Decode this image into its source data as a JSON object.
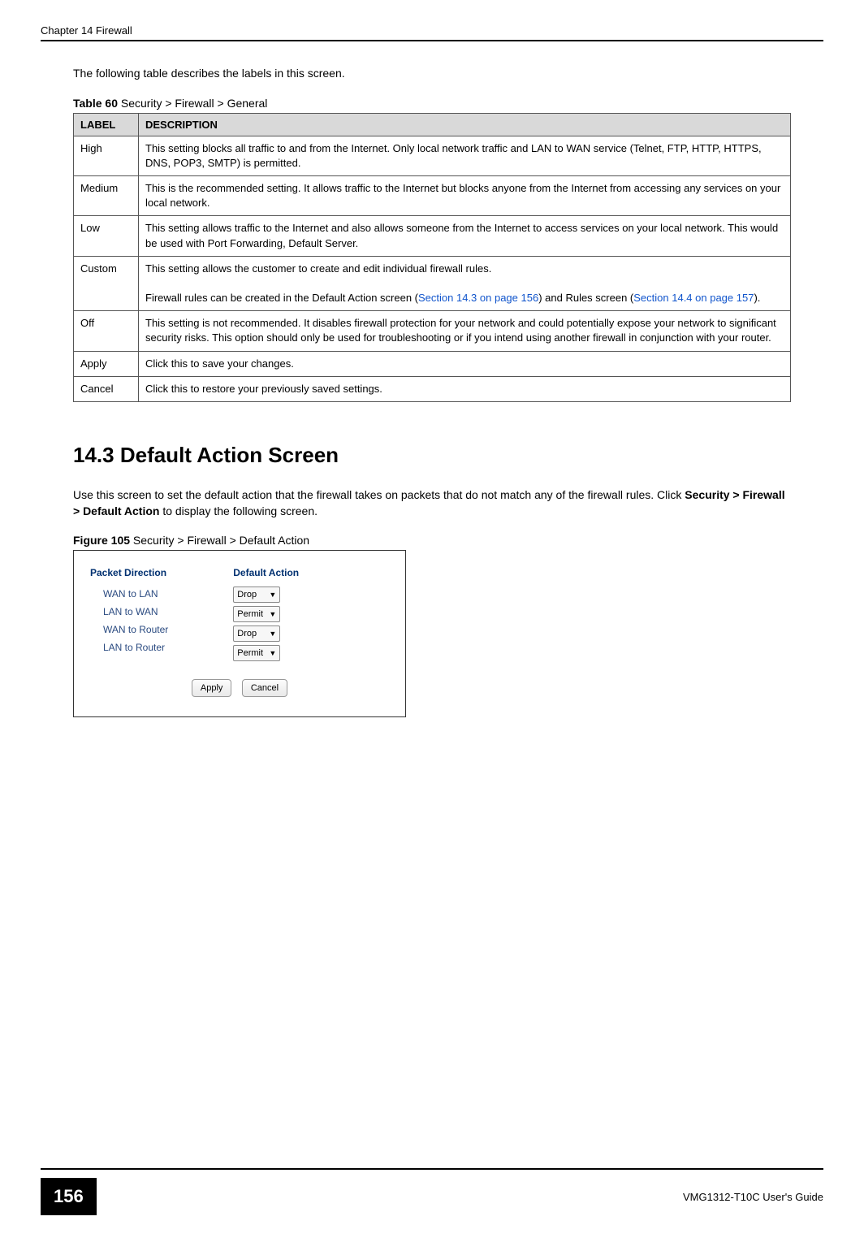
{
  "header": {
    "chapter": "Chapter 14 Firewall"
  },
  "intro": "The following table describes the labels in this screen.",
  "table_caption_prefix": "Table 60",
  "table_caption_text": "   Security > Firewall > General",
  "table": {
    "head_label": "LABEL",
    "head_desc": "DESCRIPTION",
    "rows": [
      {
        "label": "High",
        "desc": "This setting blocks all traffic to and from the Internet. Only local network traffic and LAN to WAN service (Telnet, FTP, HTTP, HTTPS, DNS, POP3, SMTP) is permitted."
      },
      {
        "label": "Medium",
        "desc": "This is the recommended setting. It allows traffic to the Internet but blocks anyone from the Internet from accessing any services on your local network."
      },
      {
        "label": "Low",
        "desc": "This setting allows traffic to the Internet and also allows someone from the Internet to access services on your local network. This would be used with Port Forwarding, Default Server."
      },
      {
        "label": "Custom",
        "desc_pre": "This setting allows the customer to create and edit individual firewall rules.",
        "desc_p2_a": "Firewall rules can be created in the Default Action screen (",
        "desc_link1": "Section 14.3 on page 156",
        "desc_p2_b": ") and Rules screen (",
        "desc_link2": "Section 14.4 on page 157",
        "desc_p2_c": ")."
      },
      {
        "label": "Off",
        "desc": "This setting is not recommended. It disables firewall protection for your network and could potentially expose your network to significant security risks. This option should only be used for troubleshooting or if you intend using another firewall in conjunction with your router."
      },
      {
        "label": "Apply",
        "desc": "Click this to save your changes."
      },
      {
        "label": "Cancel",
        "desc": "Click this to restore your previously saved settings."
      }
    ]
  },
  "section": {
    "number_title": "14.3  Default Action Screen",
    "para_a": "Use this screen to set the default action that the firewall takes on packets that do not match any of the firewall rules. Click ",
    "para_bold": "Security > Firewall > Default Action",
    "para_b": " to display the following screen."
  },
  "figure_caption_prefix": "Figure 105",
  "figure_caption_text": "   Security > Firewall > Default Action",
  "figure": {
    "pd_head": "Packet Direction",
    "da_head": "Default Action",
    "rows": [
      {
        "dir": "WAN to LAN",
        "action": "Drop"
      },
      {
        "dir": "LAN to WAN",
        "action": "Permit"
      },
      {
        "dir": "WAN to Router",
        "action": "Drop"
      },
      {
        "dir": "LAN to Router",
        "action": "Permit"
      }
    ],
    "apply": "Apply",
    "cancel": "Cancel"
  },
  "footer": {
    "page": "156",
    "guide": "VMG1312-T10C User's Guide"
  }
}
